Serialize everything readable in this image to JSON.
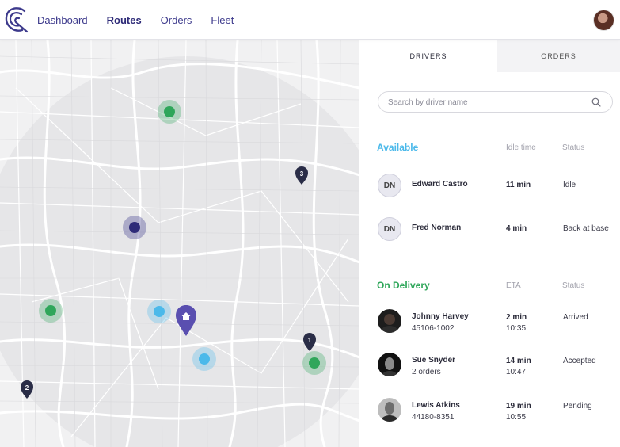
{
  "nav": {
    "items": [
      {
        "label": "Dashboard",
        "active": false
      },
      {
        "label": "Routes",
        "active": true
      },
      {
        "label": "Orders",
        "active": false
      },
      {
        "label": "Fleet",
        "active": false
      }
    ]
  },
  "colors": {
    "brand": "#3d3a8c",
    "available": "#4bb9ea",
    "on_delivery": "#2fa65a",
    "marker_dark": "#2a2d47",
    "home_marker": "#5a4fb0"
  },
  "tabs": {
    "drivers": "DRIVERS",
    "orders": "ORDERS"
  },
  "search": {
    "placeholder": "Search by driver name"
  },
  "available": {
    "title": "Available",
    "col_time": "Idle time",
    "col_status": "Status",
    "drivers": [
      {
        "initials": "DN",
        "name": "Edward Castro",
        "time": "11 min",
        "status": "Idle"
      },
      {
        "initials": "DN",
        "name": "Fred Norman",
        "time": "4 min",
        "status": "Back at base"
      }
    ]
  },
  "delivery": {
    "title": "On Delivery",
    "col_time": "ETA",
    "col_status": "Status",
    "drivers": [
      {
        "name": "Johnny Harvey",
        "sub": "45106-1002",
        "eta": "2 min",
        "clock": "10:35",
        "status": "Arrived"
      },
      {
        "name": "Sue Snyder",
        "sub": "2 orders",
        "eta": "14 min",
        "clock": "10:47",
        "status": "Accepted"
      },
      {
        "name": "Lewis Atkins",
        "sub": "44180-8351",
        "eta": "19 min",
        "clock": "10:55",
        "status": "Pending"
      }
    ]
  },
  "map": {
    "pins": [
      {
        "label": "1"
      },
      {
        "label": "2"
      },
      {
        "label": "3"
      }
    ],
    "icons": [
      "home-icon"
    ]
  }
}
